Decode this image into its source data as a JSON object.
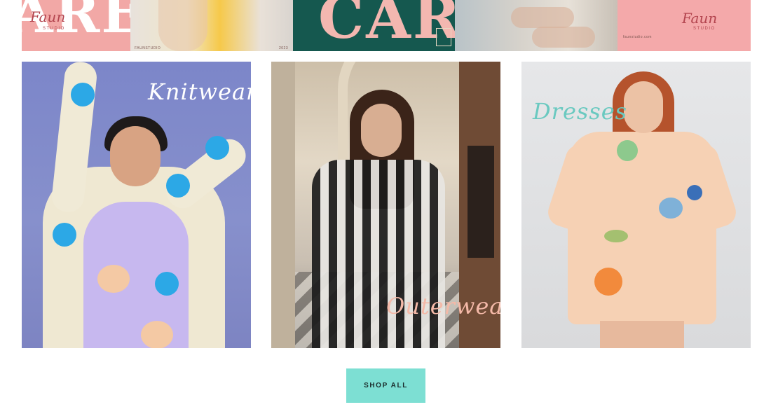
{
  "banner": {
    "panel1": {
      "big_text": "ARE",
      "logo": "Faun",
      "logo_sub": "STUDIO"
    },
    "panel2": {
      "caption_left": "FAUNSTUDIO",
      "caption_right": "2023"
    },
    "panel3": {
      "big_text": "CARE"
    },
    "panel5": {
      "logo": "Faun",
      "logo_sub": "STUDIO",
      "caption": "faunstudio.com"
    }
  },
  "categories": [
    {
      "label": "Knitwear"
    },
    {
      "label": "Outerwear"
    },
    {
      "label": "Dresses"
    }
  ],
  "cta": {
    "shop_all": "SHOP ALL"
  },
  "colors": {
    "cta_bg": "#7ddfd3",
    "knitwear_bg": "#7c86c9",
    "dresses_label": "#6ac9c0",
    "outerwear_label": "#f4b9a8"
  }
}
